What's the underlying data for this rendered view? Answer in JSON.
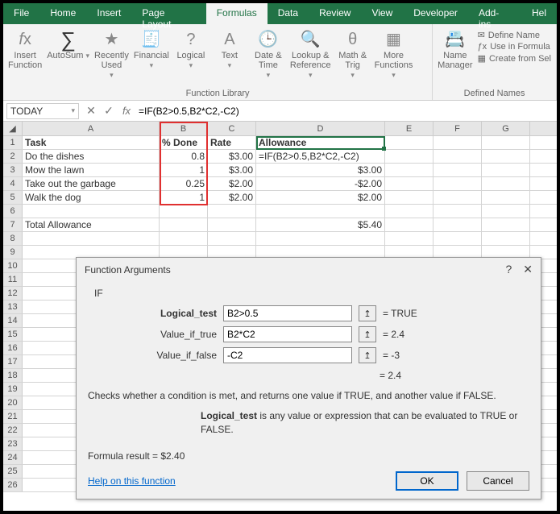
{
  "tabs": [
    "File",
    "Home",
    "Insert",
    "Page Layout",
    "Formulas",
    "Data",
    "Review",
    "View",
    "Developer",
    "Add-ins",
    "Hel"
  ],
  "active_tab": 4,
  "ribbon": {
    "insert_fn": "Insert\nFunction",
    "autosum": "AutoSum",
    "recently": "Recently\nUsed",
    "financial": "Financial",
    "logical": "Logical",
    "text": "Text",
    "datetime": "Date &\nTime",
    "lookup": "Lookup &\nReference",
    "math": "Math &\nTrig",
    "more": "More\nFunctions",
    "lib_label": "Function Library",
    "name_mgr": "Name\nManager",
    "def_name": "Define Name",
    "use_in": "Use in Formula",
    "create_from": "Create from Sel",
    "defnames_label": "Defined Names"
  },
  "fbar": {
    "name": "TODAY",
    "formula": "=IF(B2>0.5,B2*C2,-C2)"
  },
  "cols": [
    "A",
    "B",
    "C",
    "D",
    "E",
    "F",
    "G"
  ],
  "rows": [
    {
      "n": "1",
      "A": "Task",
      "B": "% Done",
      "C": "Rate",
      "D": "Allowance",
      "bold": true
    },
    {
      "n": "2",
      "A": "Do the dishes",
      "B": "0.8",
      "C": "$3.00",
      "D": "=IF(B2>0.5,B2*C2,-C2)"
    },
    {
      "n": "3",
      "A": "Mow the lawn",
      "B": "1",
      "C": "$3.00",
      "D": "$3.00"
    },
    {
      "n": "4",
      "A": "Take out the garbage",
      "B": "0.25",
      "C": "$2.00",
      "D": "-$2.00"
    },
    {
      "n": "5",
      "A": "Walk the dog",
      "B": "1",
      "C": "$2.00",
      "D": "$2.00"
    },
    {
      "n": "6",
      "A": "",
      "B": "",
      "C": "",
      "D": ""
    },
    {
      "n": "7",
      "A": "Total Allowance",
      "B": "",
      "C": "",
      "D": "$5.40"
    }
  ],
  "extra_rows": [
    "8",
    "9",
    "10",
    "11",
    "12",
    "13",
    "14",
    "15",
    "16",
    "17",
    "18",
    "19",
    "20",
    "21",
    "22",
    "23",
    "24",
    "25",
    "26"
  ],
  "dialog": {
    "title": "Function Arguments",
    "fn": "IF",
    "args": [
      {
        "label": "Logical_test",
        "value": "B2>0.5",
        "result": "TRUE",
        "bold": true
      },
      {
        "label": "Value_if_true",
        "value": "B2*C2",
        "result": "2.4"
      },
      {
        "label": "Value_if_false",
        "value": "-C2",
        "result": "-3"
      }
    ],
    "eq_result": "=  2.4",
    "desc1": "Checks whether a condition is met, and returns one value if TRUE, and another value if FALSE.",
    "desc2_b": "Logical_test",
    "desc2": "  is any value or expression that can be evaluated to TRUE or FALSE.",
    "formula_result_label": "Formula result =  ",
    "formula_result": "$2.40",
    "help": "Help on this function",
    "ok": "OK",
    "cancel": "Cancel"
  }
}
